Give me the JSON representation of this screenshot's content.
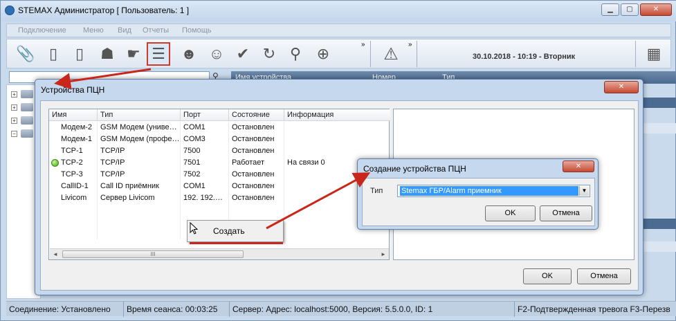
{
  "main_window": {
    "title": "STEMAX Администратор [ Пользователь: 1 ]",
    "minimize": "▁",
    "maximize": "▢",
    "close": "✕"
  },
  "menu": [
    "Подключение",
    "Меню",
    "Вид",
    "Отчеты",
    "Помощь"
  ],
  "toolbar": {
    "icons": [
      "paperclip-icon",
      "device-add-icon",
      "device-remove-icon",
      "users-icon",
      "hand-icon",
      "pcn-devices-icon",
      "user-icon",
      "user-card-icon",
      "check-icon",
      "refresh-icon",
      "search-icon",
      "zoom-icon"
    ],
    "more": "»",
    "alarm_more": "»",
    "datetime": "30.10.2018 - 10:19 - Вторник"
  },
  "device_list_header": [
    "Имя устройства",
    "Номер",
    "Тип"
  ],
  "pcn_dialog": {
    "title": "Устройства ПЦН",
    "close": "✕",
    "columns": [
      "Имя",
      "Тип",
      "Порт",
      "Состояние",
      "Информация"
    ],
    "rows": [
      {
        "name": "Модем-2",
        "type": "GSM Модем (униве…",
        "port": "COM1",
        "state": "Остановлен",
        "info": "",
        "active": false
      },
      {
        "name": "Модем-1",
        "type": "GSM Модем (профе…",
        "port": "COM3",
        "state": "Остановлен",
        "info": "",
        "active": false
      },
      {
        "name": "TCP-1",
        "type": "TCP/IP",
        "port": "7500",
        "state": "Остановлен",
        "info": "",
        "active": false
      },
      {
        "name": "TCP-2",
        "type": "TCP/IP",
        "port": "7501",
        "state": "Работает",
        "info": "На связи 0",
        "active": true
      },
      {
        "name": "TCP-3",
        "type": "TCP/IP",
        "port": "7502",
        "state": "Остановлен",
        "info": "",
        "active": false
      },
      {
        "name": "CallID-1",
        "type": "Call ID приёмник",
        "port": "COM1",
        "state": "Остановлен",
        "info": "",
        "active": false
      },
      {
        "name": "Livicom",
        "type": "Сервер Livicom",
        "port": "192. 192.…",
        "state": "Остановлен",
        "info": "",
        "active": false
      }
    ],
    "scroll_thumb": "III",
    "scroll_left": "◄",
    "scroll_right": "►",
    "ok": "OK",
    "cancel": "Отмена"
  },
  "context_menu": {
    "create": "Создать"
  },
  "create_dialog": {
    "title": "Создание устройства ПЦН",
    "close": "✕",
    "type_label": "Тип",
    "type_value": "Stemax ГБР/Alarm приемник",
    "dropdown": "▼",
    "ok": "OK",
    "cancel": "Отмена"
  },
  "status_bar": {
    "connection": "Соединение: Установлено",
    "session": "Время сеанса: 00:03:25",
    "server": "Сервер: Адрес: localhost:5000, Версия: 5.5.0.0, ID: 1",
    "hotkeys": "F2-Подтвержденная тревога  F3-Перезв"
  },
  "colors": {
    "accent_red": "#c9271b",
    "selection_blue": "#3399ff",
    "active_green": "#43a50e"
  }
}
